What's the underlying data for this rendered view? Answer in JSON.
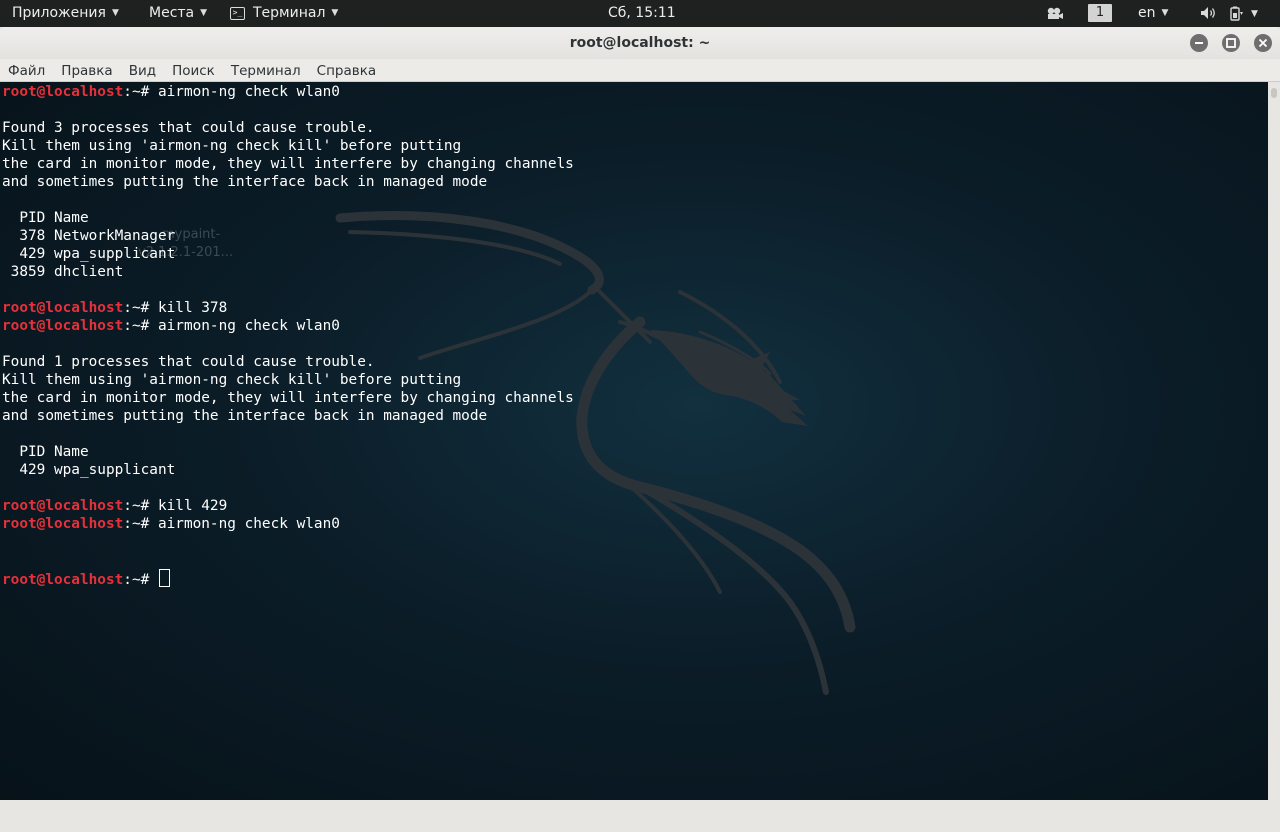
{
  "top_panel": {
    "applications": "Приложения",
    "places": "Места",
    "terminal_app": "Терминал",
    "clock": "Сб, 15:11",
    "workspace": "1",
    "keyboard_layout": "en"
  },
  "window": {
    "title": "root@localhost: ~",
    "minimize_icon": "minimize-icon",
    "maximize_icon": "maximize-icon",
    "close_icon": "close-icon"
  },
  "menubar": {
    "items": [
      "Файл",
      "Правка",
      "Вид",
      "Поиск",
      "Терминал",
      "Справка"
    ]
  },
  "desktop_ghost": {
    "label1": "mypaint-",
    "label2": "v2.1.2.1-201..."
  },
  "terminal": {
    "prompt_user": "root@localhost",
    "prompt_suffix": ":~# ",
    "lines": [
      {
        "type": "prompt",
        "cmd": "airmon-ng check wlan0"
      },
      {
        "type": "text",
        "text": ""
      },
      {
        "type": "text",
        "text": "Found 3 processes that could cause trouble."
      },
      {
        "type": "text",
        "text": "Kill them using 'airmon-ng check kill' before putting"
      },
      {
        "type": "text",
        "text": "the card in monitor mode, they will interfere by changing channels"
      },
      {
        "type": "text",
        "text": "and sometimes putting the interface back in managed mode"
      },
      {
        "type": "text",
        "text": ""
      },
      {
        "type": "text",
        "text": "  PID Name"
      },
      {
        "type": "text",
        "text": "  378 NetworkManager"
      },
      {
        "type": "text",
        "text": "  429 wpa_supplicant"
      },
      {
        "type": "text",
        "text": " 3859 dhclient"
      },
      {
        "type": "text",
        "text": ""
      },
      {
        "type": "prompt",
        "cmd": "kill 378"
      },
      {
        "type": "prompt",
        "cmd": "airmon-ng check wlan0"
      },
      {
        "type": "text",
        "text": ""
      },
      {
        "type": "text",
        "text": "Found 1 processes that could cause trouble."
      },
      {
        "type": "text",
        "text": "Kill them using 'airmon-ng check kill' before putting"
      },
      {
        "type": "text",
        "text": "the card in monitor mode, they will interfere by changing channels"
      },
      {
        "type": "text",
        "text": "and sometimes putting the interface back in managed mode"
      },
      {
        "type": "text",
        "text": ""
      },
      {
        "type": "text",
        "text": "  PID Name"
      },
      {
        "type": "text",
        "text": "  429 wpa_supplicant"
      },
      {
        "type": "text",
        "text": ""
      },
      {
        "type": "prompt",
        "cmd": "kill 429"
      },
      {
        "type": "prompt",
        "cmd": "airmon-ng check wlan0"
      },
      {
        "type": "text",
        "text": ""
      },
      {
        "type": "text",
        "text": ""
      },
      {
        "type": "prompt_cursor",
        "cmd": ""
      }
    ]
  },
  "colors": {
    "prompt_user": "#e8303a",
    "terminal_bg": "#0b1d28",
    "panel_bg": "#1f2121"
  }
}
